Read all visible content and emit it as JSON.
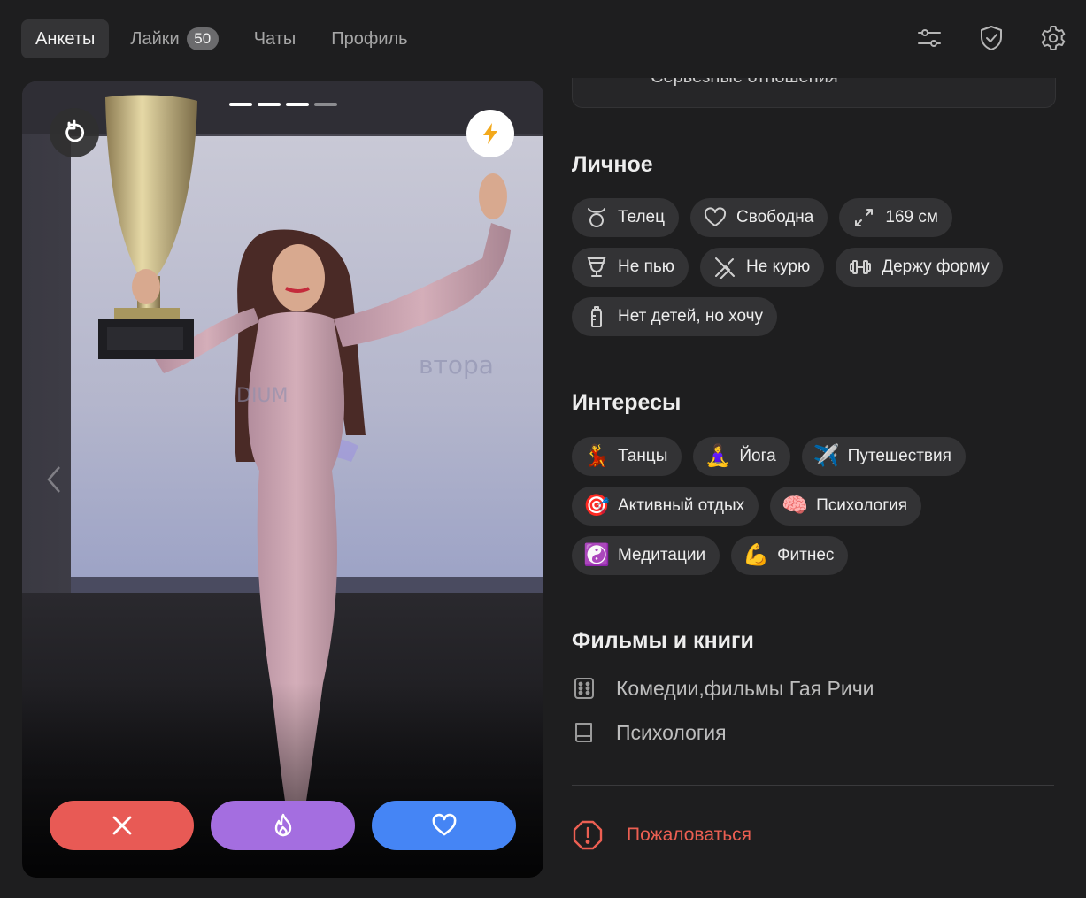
{
  "nav": {
    "tabs": [
      {
        "label": "Анкеты",
        "active": true
      },
      {
        "label": "Лайки",
        "badge": "50"
      },
      {
        "label": "Чаты"
      },
      {
        "label": "Профиль"
      }
    ],
    "icons": [
      "sliders-icon",
      "shield-check-icon",
      "gear-icon"
    ]
  },
  "card": {
    "photo_count": 4,
    "photo_index": 3,
    "actions": [
      {
        "name": "dislike",
        "icon": "close-icon",
        "color": "#e85a55"
      },
      {
        "name": "super-like",
        "icon": "flame-icon",
        "color": "#a46ee0"
      },
      {
        "name": "like",
        "icon": "heart-icon",
        "color": "#4585f5"
      }
    ]
  },
  "relationship": {
    "text": "Серьёзные отношения"
  },
  "personal": {
    "title": "Личное",
    "chips": [
      {
        "label": "Телец",
        "icon": "taurus-icon"
      },
      {
        "label": "Свободна",
        "icon": "heart-outline-icon"
      },
      {
        "label": "169 см",
        "icon": "height-arrows-icon"
      },
      {
        "label": "Не пью",
        "icon": "wine-glass-icon"
      },
      {
        "label": "Не курю",
        "icon": "no-smoking-icon"
      },
      {
        "label": "Держу форму",
        "icon": "dumbbell-icon"
      },
      {
        "label": "Нет детей, но хочу",
        "icon": "baby-bottle-icon"
      }
    ]
  },
  "interests": {
    "title": "Интересы",
    "chips": [
      {
        "label": "Танцы",
        "emoji": "💃"
      },
      {
        "label": "Йога",
        "emoji": "🧘‍♀️"
      },
      {
        "label": "Путешествия",
        "emoji": "✈️"
      },
      {
        "label": "Активный отдых",
        "emoji": "🎯"
      },
      {
        "label": "Психология",
        "emoji": "🧠"
      },
      {
        "label": "Медитации",
        "emoji": "☯️"
      },
      {
        "label": "Фитнес",
        "emoji": "💪"
      }
    ]
  },
  "media": {
    "title": "Фильмы и книги",
    "items": [
      {
        "label": "Комедии,фильмы Гая Ричи",
        "icon": "film-icon"
      },
      {
        "label": "Психология",
        "icon": "book-icon"
      }
    ]
  },
  "report": {
    "label": "Пожаловаться",
    "color": "#ec5f52"
  }
}
